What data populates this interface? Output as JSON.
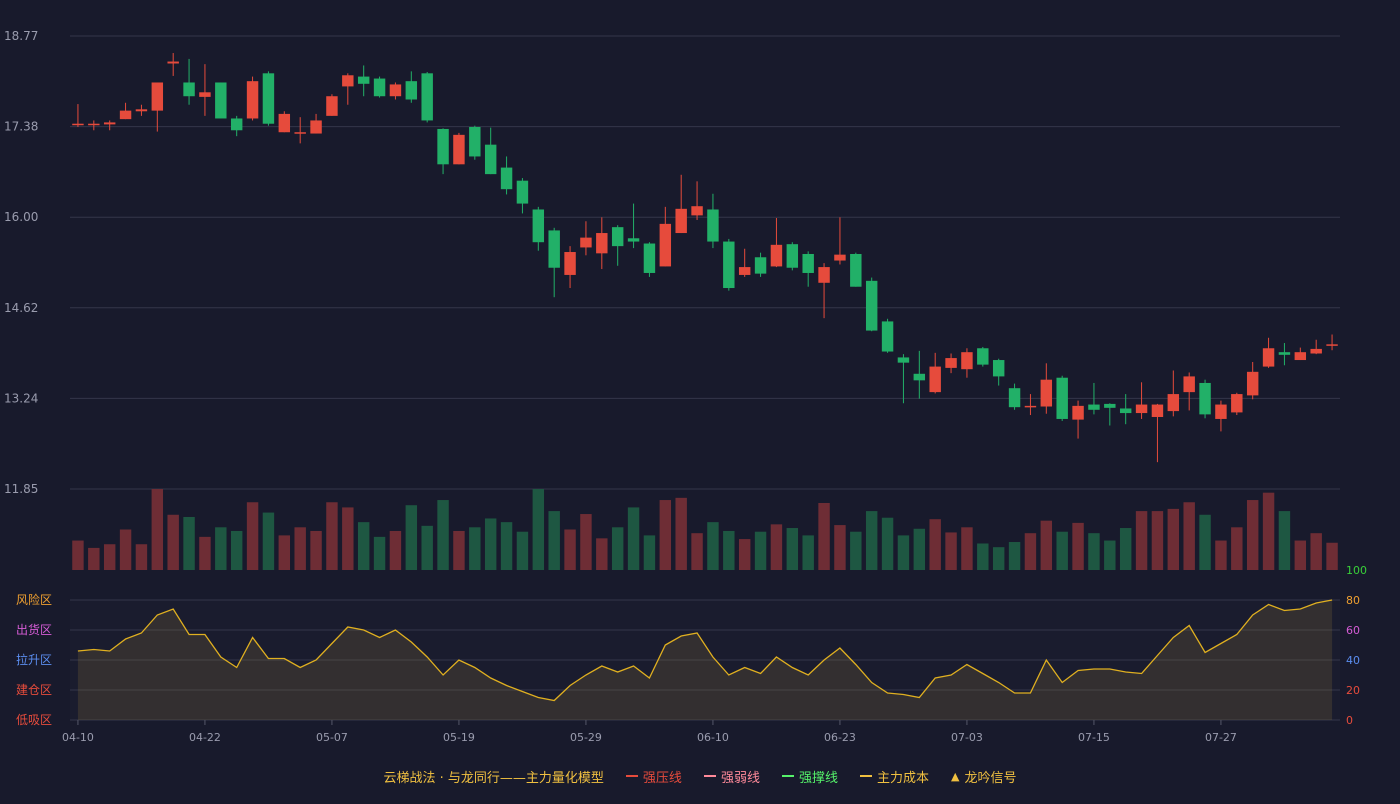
{
  "chart_data": {
    "type": "candlestick",
    "price_axis": {
      "ylim": [
        11.85,
        18.77
      ],
      "ticks": [
        "18.77",
        "17.38",
        "16.00",
        "14.62",
        "13.24",
        "11.85"
      ]
    },
    "indicator_axis": {
      "ylim": [
        0,
        100
      ],
      "ticks": [
        "0",
        "20",
        "40",
        "60",
        "80",
        "100"
      ],
      "zones": [
        "风险区",
        "出货区",
        "拉升区",
        "建仓区",
        "低吸区"
      ],
      "tick_colors": [
        "#e74c3c",
        "#e74c3c",
        "#5b8def",
        "#d65cd6",
        "#f0a030",
        "#38d038"
      ],
      "zone_colors": [
        "#f0a030",
        "#d65cd6",
        "#5b8def",
        "#e74c3c",
        "#e74c3c"
      ]
    },
    "x_labels": [
      "04-10",
      "04-22",
      "05-07",
      "05-19",
      "05-29",
      "06-10",
      "06-23",
      "07-03",
      "07-15",
      "07-27"
    ],
    "x_label_index": [
      0,
      8,
      16,
      24,
      32,
      40,
      48,
      56,
      64,
      72
    ],
    "colors": {
      "up": "#e64b3c",
      "down": "#22b068",
      "vol_up": "#6e2d35",
      "vol_down": "#1e5742",
      "indicator_line": "#e0b020",
      "grid": "#34364a"
    },
    "ohlc": [
      [
        17.43,
        17.43,
        17.38,
        17.73
      ],
      [
        17.42,
        17.43,
        17.33,
        17.48
      ],
      [
        17.42,
        17.45,
        17.33,
        17.48
      ],
      [
        17.5,
        17.63,
        17.5,
        17.75
      ],
      [
        17.62,
        17.65,
        17.55,
        17.72
      ],
      [
        17.63,
        18.06,
        17.31,
        18.06
      ],
      [
        18.35,
        18.38,
        18.16,
        18.51
      ],
      [
        18.06,
        17.85,
        17.72,
        18.42
      ],
      [
        17.84,
        17.91,
        17.55,
        18.34
      ],
      [
        18.06,
        17.51,
        17.51,
        18.06
      ],
      [
        17.51,
        17.33,
        17.24,
        17.55
      ],
      [
        17.51,
        18.08,
        17.48,
        18.15
      ],
      [
        18.2,
        17.43,
        17.4,
        18.23
      ],
      [
        17.3,
        17.58,
        17.3,
        17.62
      ],
      [
        17.3,
        17.3,
        17.13,
        17.53
      ],
      [
        17.28,
        17.48,
        17.28,
        17.58
      ],
      [
        17.55,
        17.85,
        17.55,
        17.88
      ],
      [
        18.0,
        18.17,
        17.72,
        18.2
      ],
      [
        18.15,
        18.04,
        17.85,
        18.32
      ],
      [
        18.12,
        17.85,
        17.83,
        18.15
      ],
      [
        17.85,
        18.03,
        17.8,
        18.06
      ],
      [
        18.08,
        17.8,
        17.75,
        18.23
      ],
      [
        18.2,
        17.48,
        17.45,
        18.22
      ],
      [
        17.35,
        16.81,
        16.66,
        17.36
      ],
      [
        16.81,
        17.26,
        16.81,
        17.29
      ],
      [
        17.38,
        16.93,
        16.88,
        17.4
      ],
      [
        17.11,
        16.66,
        16.66,
        17.37
      ],
      [
        16.76,
        16.43,
        16.35,
        16.93
      ],
      [
        16.56,
        16.21,
        16.06,
        16.6
      ],
      [
        16.12,
        15.62,
        15.49,
        16.16
      ],
      [
        15.8,
        15.23,
        14.78,
        15.84
      ],
      [
        15.12,
        15.47,
        14.92,
        15.56
      ],
      [
        15.54,
        15.69,
        15.42,
        15.94
      ],
      [
        15.45,
        15.76,
        15.21,
        16.0
      ],
      [
        15.85,
        15.56,
        15.26,
        15.88
      ],
      [
        15.68,
        15.63,
        15.53,
        16.21
      ],
      [
        15.6,
        15.15,
        15.09,
        15.62
      ],
      [
        15.25,
        15.9,
        15.25,
        16.16
      ],
      [
        15.76,
        16.13,
        15.76,
        16.65
      ],
      [
        16.03,
        16.17,
        15.96,
        16.55
      ],
      [
        16.12,
        15.63,
        15.53,
        16.36
      ],
      [
        15.63,
        14.92,
        14.88,
        15.67
      ],
      [
        15.12,
        15.24,
        15.09,
        15.52
      ],
      [
        15.39,
        15.14,
        15.09,
        15.46
      ],
      [
        15.25,
        15.58,
        15.24,
        15.99
      ],
      [
        15.59,
        15.23,
        15.19,
        15.62
      ],
      [
        15.44,
        15.15,
        14.94,
        15.48
      ],
      [
        15.0,
        15.24,
        14.46,
        15.3
      ],
      [
        15.34,
        15.43,
        15.28,
        16.0
      ],
      [
        15.44,
        14.94,
        14.94,
        15.46
      ],
      [
        15.03,
        14.27,
        14.26,
        15.08
      ],
      [
        14.41,
        13.95,
        13.93,
        14.45
      ],
      [
        13.86,
        13.78,
        13.16,
        13.91
      ],
      [
        13.61,
        13.51,
        13.23,
        13.96
      ],
      [
        13.33,
        13.72,
        13.31,
        13.93
      ],
      [
        13.7,
        13.85,
        13.62,
        13.92
      ],
      [
        13.68,
        13.94,
        13.55,
        14.0
      ],
      [
        14.0,
        13.75,
        13.72,
        14.02
      ],
      [
        13.82,
        13.57,
        13.43,
        13.84
      ],
      [
        13.39,
        13.1,
        13.06,
        13.46
      ],
      [
        13.11,
        13.12,
        12.98,
        13.3
      ],
      [
        13.11,
        13.52,
        13.0,
        13.77
      ],
      [
        13.55,
        12.92,
        12.89,
        13.58
      ],
      [
        12.91,
        13.12,
        12.62,
        13.2
      ],
      [
        13.14,
        13.06,
        12.99,
        13.47
      ],
      [
        13.15,
        13.09,
        12.82,
        13.16
      ],
      [
        13.08,
        13.01,
        12.84,
        13.3
      ],
      [
        13.01,
        13.14,
        12.92,
        13.48
      ],
      [
        12.95,
        13.14,
        12.26,
        13.15
      ],
      [
        13.04,
        13.3,
        12.96,
        13.66
      ],
      [
        13.33,
        13.57,
        13.05,
        13.63
      ],
      [
        13.47,
        12.99,
        12.93,
        13.52
      ],
      [
        12.92,
        13.14,
        12.73,
        13.2
      ],
      [
        13.02,
        13.3,
        12.98,
        13.32
      ],
      [
        13.28,
        13.64,
        13.22,
        13.79
      ],
      [
        13.72,
        14.0,
        13.7,
        14.16
      ],
      [
        13.94,
        13.9,
        13.74,
        14.08
      ],
      [
        13.82,
        13.94,
        13.82,
        14.01
      ],
      [
        13.92,
        13.99,
        13.91,
        14.13
      ],
      [
        14.06,
        14.06,
        13.97,
        14.21
      ]
    ],
    "volume": [
      40,
      30,
      35,
      55,
      35,
      110,
      75,
      72,
      45,
      58,
      53,
      92,
      78,
      47,
      58,
      53,
      92,
      85,
      65,
      45,
      53,
      88,
      60,
      95,
      53,
      58,
      70,
      65,
      52,
      110,
      80,
      55,
      76,
      43,
      58,
      85,
      47,
      95,
      98,
      50,
      65,
      53,
      42,
      52,
      62,
      57,
      47,
      91,
      61,
      52,
      80,
      71,
      47,
      56,
      69,
      51,
      58,
      36,
      31,
      38,
      50,
      67,
      52,
      64,
      50,
      40,
      57,
      80,
      80,
      83,
      92,
      75,
      40,
      58,
      95,
      105,
      80,
      40,
      50,
      37
    ],
    "indicator": [
      46,
      47,
      46,
      54,
      58,
      70,
      74,
      57,
      57,
      42,
      35,
      55,
      41,
      41,
      35,
      40,
      51,
      62,
      60,
      55,
      60,
      52,
      42,
      30,
      40,
      35,
      28,
      23,
      19,
      15,
      13,
      23,
      30,
      36,
      32,
      36,
      28,
      50,
      56,
      58,
      42,
      30,
      35,
      31,
      42,
      35,
      30,
      40,
      48,
      37,
      25,
      18,
      17,
      15,
      28,
      30,
      37,
      31,
      25,
      18,
      18,
      40,
      25,
      33,
      34,
      34,
      32,
      31,
      43,
      55,
      63,
      45,
      51,
      57,
      70,
      77,
      73,
      74,
      78,
      80
    ]
  },
  "legend": {
    "title": "云梯战法 · 与龙同行——主力量化模型",
    "items": [
      {
        "label": "强压线",
        "color": "#e64b3c",
        "style": "solid",
        "icon": "solid-line-icon"
      },
      {
        "label": "强弱线",
        "color": "#ff8a9a",
        "style": "dashed",
        "icon": "dashed-line-icon"
      },
      {
        "label": "强撑线",
        "color": "#55f26a",
        "style": "solid",
        "icon": "solid-line-icon"
      },
      {
        "label": "主力成本",
        "color": "#f0c040",
        "style": "dashed",
        "icon": "dashed-line-icon"
      },
      {
        "label": "龙吟信号",
        "color": "#f0c040",
        "style": "triangle",
        "icon": "triangle-up-icon"
      }
    ]
  }
}
